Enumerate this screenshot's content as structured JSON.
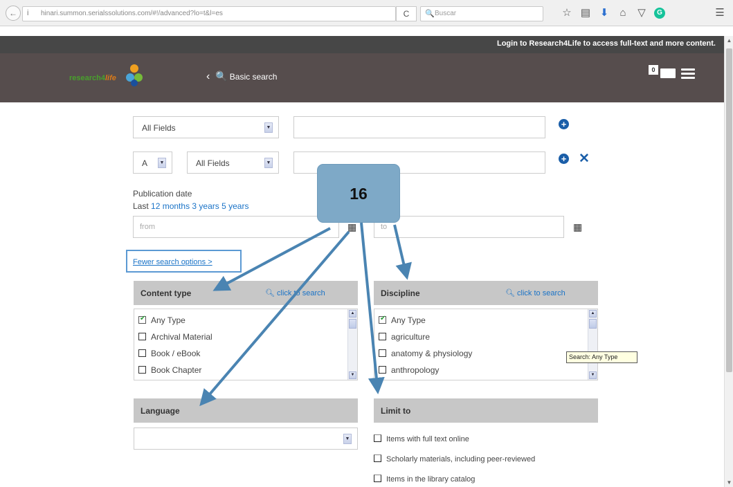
{
  "browser": {
    "url": "hinari.summon.serialssolutions.com/#!/advanced?lo=t&l=es",
    "search_placeholder": "Buscar",
    "reload_glyph": "C",
    "info_glyph": "i",
    "back_glyph": "←",
    "toolbar_icons": [
      "star-icon",
      "clipboard-icon",
      "download-icon",
      "home-icon",
      "pocket-icon",
      "grammarly-icon",
      "menu-icon"
    ]
  },
  "header": {
    "login_message": "Login to Research4Life to access full-text and more content.",
    "logo_text": "research4",
    "logo_text_italic": "life",
    "basic_search_label": "Basic search",
    "back_chevron": "‹",
    "folder_count": "0"
  },
  "search_rows": [
    {
      "field": "All Fields",
      "value": ""
    },
    {
      "operator": "A",
      "field": "All Fields",
      "value": ""
    }
  ],
  "publication_date": {
    "label": "Publication date",
    "last_label": "Last",
    "link_12_months": "12 months",
    "link_3_years": "3 years",
    "link_5_years": "5 years",
    "from_placeholder": "from",
    "to_placeholder": "to"
  },
  "fewer_options_label": "Fewer search options >",
  "content_type": {
    "title": "Content type",
    "click_to_search": "click to search",
    "options": [
      {
        "label": "Any Type",
        "checked": true
      },
      {
        "label": "Archival Material",
        "checked": false
      },
      {
        "label": "Book / eBook",
        "checked": false
      },
      {
        "label": "Book Chapter",
        "checked": false
      }
    ]
  },
  "discipline": {
    "title": "Discipline",
    "click_to_search": "click to search",
    "options": [
      {
        "label": "Any Type",
        "checked": true
      },
      {
        "label": "agriculture",
        "checked": false
      },
      {
        "label": "anatomy & physiology",
        "checked": false
      },
      {
        "label": "anthropology",
        "checked": false
      }
    ]
  },
  "tooltip_text": "Search: Any Type",
  "language": {
    "title": "Language",
    "value": ""
  },
  "limit_to": {
    "title": "Limit to",
    "options": [
      {
        "label": "Items with full text online",
        "checked": false
      },
      {
        "label": "Scholarly materials, including peer-reviewed",
        "checked": false
      },
      {
        "label": "Items in the library catalog",
        "checked": false
      }
    ]
  },
  "callout": {
    "number": "16",
    "color": "#7ea9c7",
    "arrow_color": "#4a84b2"
  },
  "colors": {
    "header_dark": "#474747",
    "header_nav": "#564d4d",
    "panel_header": "#c7c7c7",
    "link_blue": "#1a73c7",
    "icon_blue": "#1a5ea8"
  }
}
